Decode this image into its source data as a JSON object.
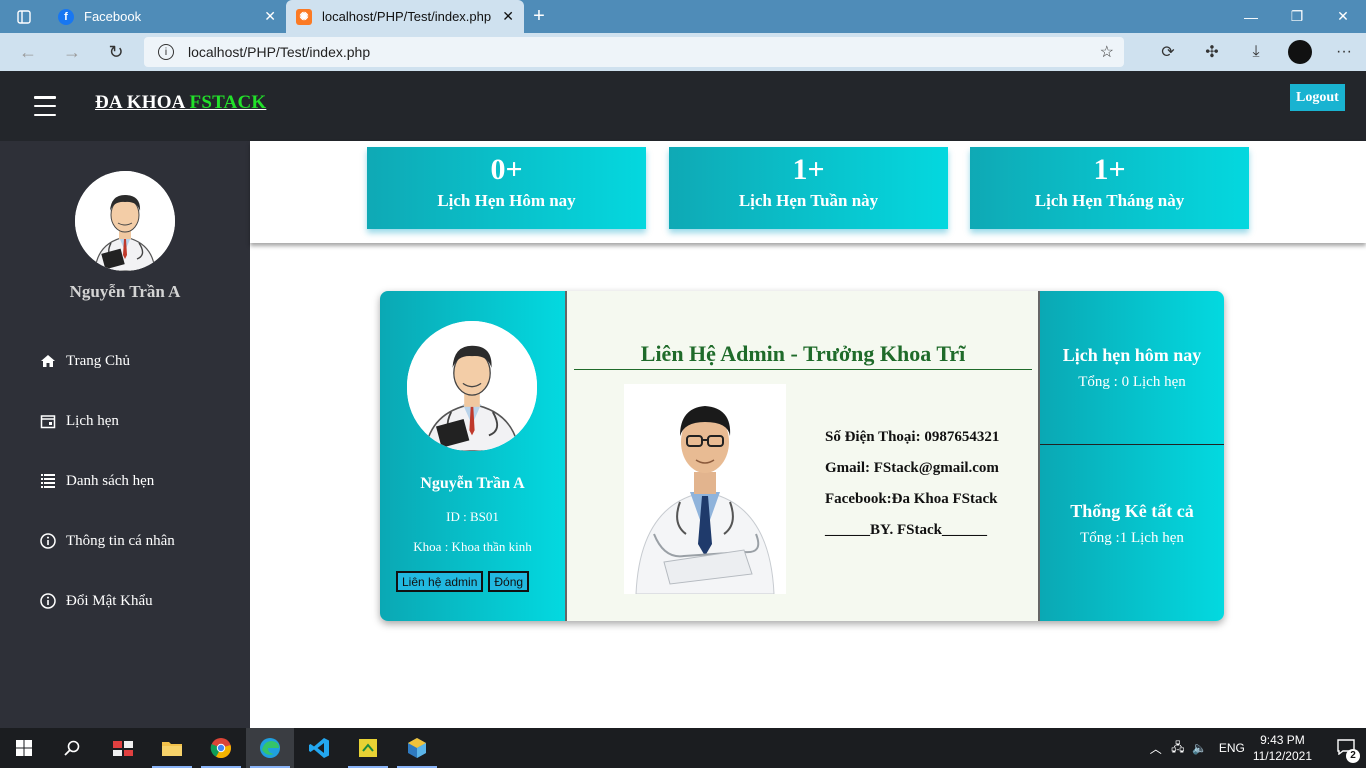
{
  "browser": {
    "tabs": [
      {
        "title": "Facebook",
        "active": false
      },
      {
        "title": "localhost/PHP/Test/index.php",
        "active": true
      }
    ],
    "url": "localhost/PHP/Test/index.php"
  },
  "header": {
    "brand_prefix": "ĐA KHOA",
    "brand_accent": "FSTACK",
    "logout_label": "Logout"
  },
  "sidebar": {
    "user_name": "Nguyễn Trần A",
    "items": [
      {
        "label": "Trang Chủ",
        "icon": "home-icon"
      },
      {
        "label": "Lịch hẹn",
        "icon": "calendar-icon"
      },
      {
        "label": "Danh sách hẹn",
        "icon": "list-icon"
      },
      {
        "label": "Thông tin cá nhân",
        "icon": "info-icon"
      },
      {
        "label": "Đổi Mật Khẩu",
        "icon": "info-icon"
      }
    ]
  },
  "stats": [
    {
      "value": "0+",
      "label": "Lịch Hẹn Hôm nay"
    },
    {
      "value": "1+",
      "label": "Lịch Hẹn Tuần này"
    },
    {
      "value": "1+",
      "label": "Lịch Hẹn Tháng này"
    }
  ],
  "card": {
    "name": "Nguyễn Trần A",
    "id": "ID : BS01",
    "dept": "Khoa : Khoa thần kinh",
    "contact_button": "Liên hệ admin",
    "close_button": "Đóng",
    "contact_title": "Liên Hệ Admin - Trưởng Khoa Trĩ",
    "phone": "Số Điện Thoại: 0987654321",
    "email": "Gmail: FStack@gmail.com",
    "facebook": "Facebook:Đa Khoa FStack",
    "signature": "______BY. FStack______",
    "today_title": "Lịch hẹn hôm nay",
    "today_total": "Tổng : 0 Lịch hẹn",
    "all_title": "Thống Kê tất cả",
    "all_total": "Tổng :1 Lịch hẹn"
  },
  "taskbar": {
    "lang": "ENG",
    "time": "9:43 PM",
    "date": "11/12/2021",
    "notifications": "2"
  },
  "colors": {
    "accent_teal": "#03d9e0",
    "brand_green": "#22e02a",
    "sidebar_bg": "#2e3038",
    "header_bg": "#23262b",
    "contact_title": "#1f6b2a"
  }
}
